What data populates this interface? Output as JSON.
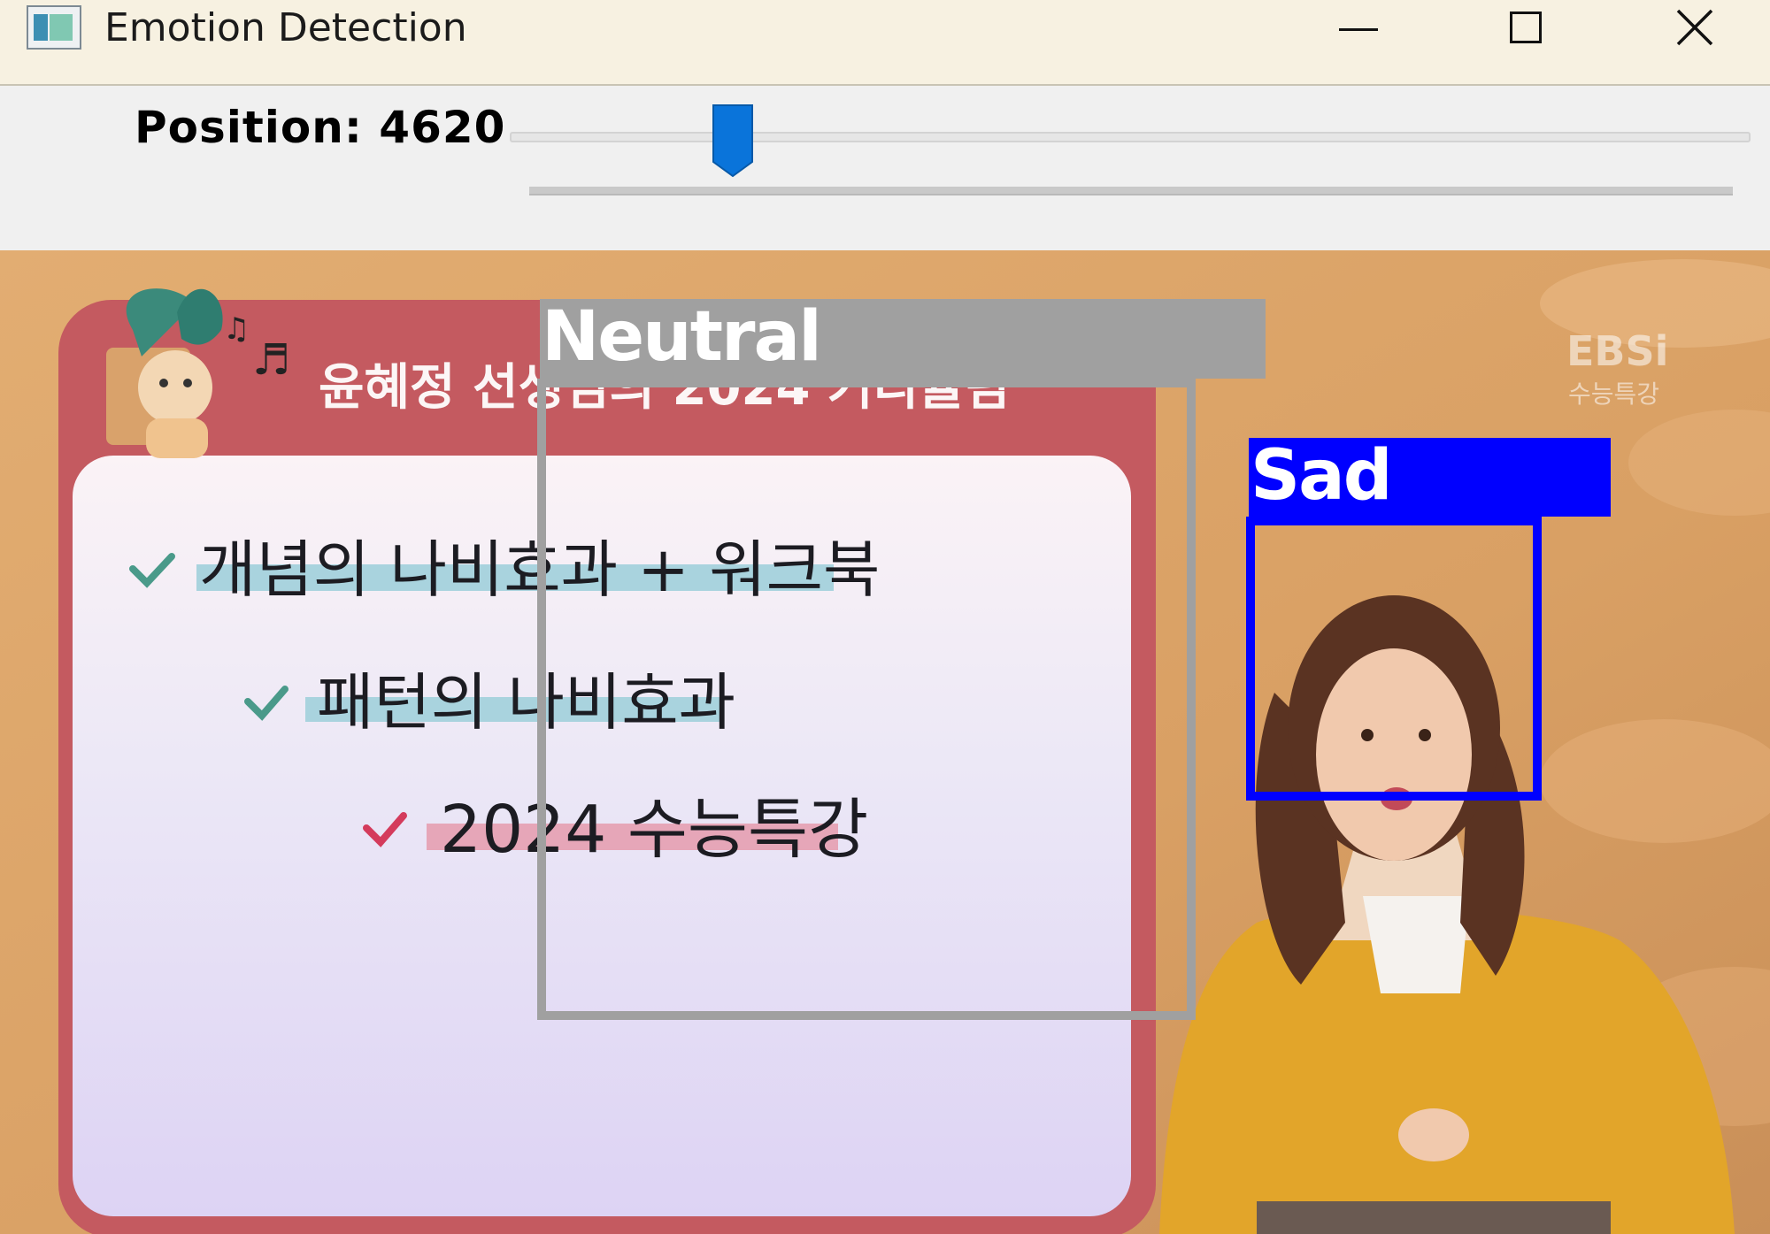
{
  "window": {
    "title": "Emotion Detection",
    "icon": "app-window-icon",
    "controls": [
      "minimize-icon",
      "maximize-icon",
      "close-icon"
    ]
  },
  "trackbar": {
    "label": "Position: 4620",
    "value_fraction": 0.18,
    "thumb_color": "#0a74da"
  },
  "video": {
    "board": {
      "header": "윤혜정 선생님의 2024 커리큘럼",
      "items": [
        {
          "text": "개념의 나비효과 + 워크북",
          "check_color": "#4a9a8a",
          "highlight": "#a9d3de"
        },
        {
          "text": "패턴의 나비효과",
          "check_color": "#4a9a8a",
          "highlight": "#a9d3de"
        },
        {
          "text": "2024 수능특강",
          "check_color": "#d43b5c",
          "highlight": "#e6a6b8"
        }
      ]
    },
    "watermark": {
      "brand": "EBSi",
      "sub": "수능특강"
    },
    "detections": [
      {
        "label": "Neutral",
        "color": "#a0a0a0"
      },
      {
        "label": "Sad",
        "color": "#0000ff"
      }
    ]
  }
}
